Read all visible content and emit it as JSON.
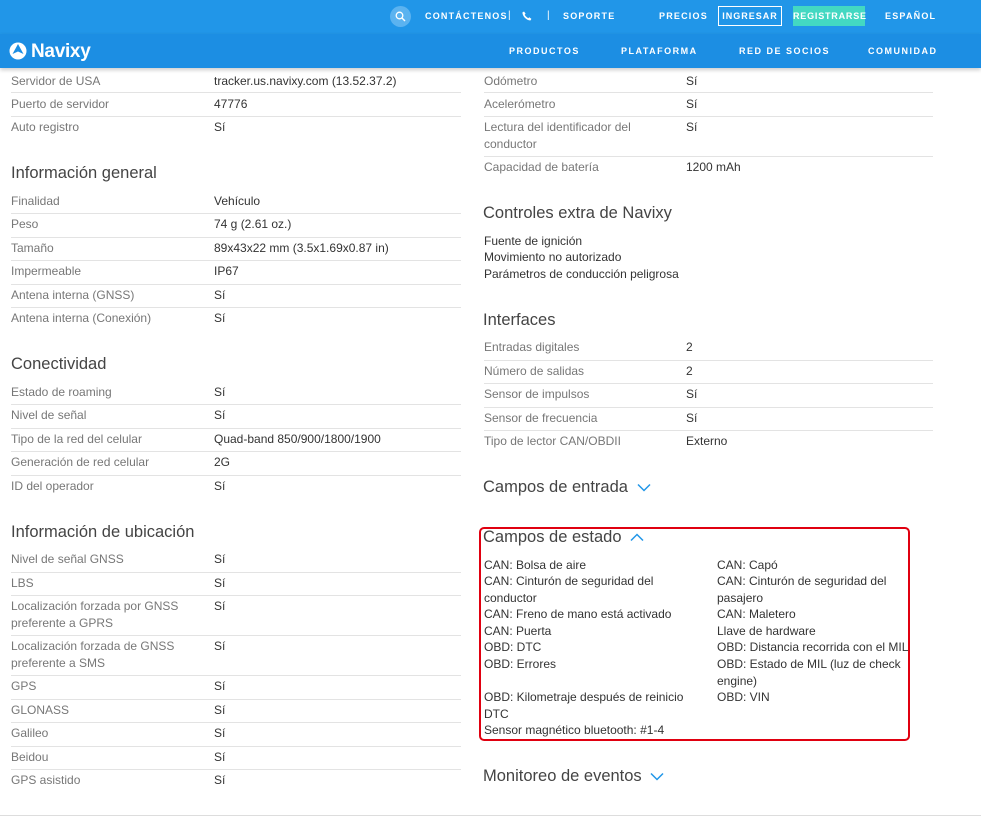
{
  "topbar": {
    "contact": "CONTÁCTENOS",
    "separator": "|",
    "support": "SOPORTE",
    "prices": "PRECIOS",
    "login": "INGRESAR",
    "register": "REGISTRARSE",
    "language": "ESPAÑOL"
  },
  "navbar": {
    "brand": "Navixy",
    "items": [
      "PRODUCTOS",
      "PLATAFORMA",
      "RED DE SOCIOS",
      "COMUNIDAD"
    ]
  },
  "left": {
    "top_rows": [
      {
        "k": "Servidor de USA",
        "v": "tracker.us.navixy.com (13.52.37.2)"
      },
      {
        "k": "Puerto de servidor",
        "v": "47776"
      },
      {
        "k": "Auto registro",
        "v": "Sí"
      }
    ],
    "general": {
      "title": "Información general",
      "rows": [
        {
          "k": "Finalidad",
          "v": "Vehículo"
        },
        {
          "k": "Peso",
          "v": "74 g (2.61 oz.)"
        },
        {
          "k": "Tamaño",
          "v": "89x43x22 mm (3.5x1.69x0.87 in)"
        },
        {
          "k": "Impermeable",
          "v": "IP67"
        },
        {
          "k": "Antena interna (GNSS)",
          "v": "Sí"
        },
        {
          "k": "Antena interna (Conexión)",
          "v": "Sí"
        }
      ]
    },
    "connectivity": {
      "title": "Conectividad",
      "rows": [
        {
          "k": "Estado de roaming",
          "v": "Sí"
        },
        {
          "k": "Nivel de señal",
          "v": "Sí"
        },
        {
          "k": "Tipo de la red del celular",
          "v": "Quad-band 850/900/1800/1900"
        },
        {
          "k": "Generación de red celular",
          "v": "2G"
        },
        {
          "k": "ID del operador",
          "v": "Sí"
        }
      ]
    },
    "location": {
      "title": "Información de ubicación",
      "rows": [
        {
          "k": "Nivel de señal GNSS",
          "v": "Sí"
        },
        {
          "k": "LBS",
          "v": "Sí"
        },
        {
          "k": "Localización forzada por GNSS preferente a GPRS",
          "v": "Sí"
        },
        {
          "k": "Localización forzada de GNSS preferente a SMS",
          "v": "Sí"
        },
        {
          "k": "GPS",
          "v": "Sí"
        },
        {
          "k": "GLONASS",
          "v": "Sí"
        },
        {
          "k": "Galileo",
          "v": "Sí"
        },
        {
          "k": "Beidou",
          "v": "Sí"
        },
        {
          "k": "GPS asistido",
          "v": "Sí"
        }
      ]
    }
  },
  "right": {
    "top_rows": [
      {
        "k": "Odómetro",
        "v": "Sí"
      },
      {
        "k": "Acelerómetro",
        "v": "Sí"
      },
      {
        "k": "Lectura del identificador del conductor",
        "v": "Sí"
      },
      {
        "k": "Capacidad de batería",
        "v": "1200 mAh"
      }
    ],
    "extra": {
      "title": "Controles extra de Navixy",
      "items": [
        "Fuente de ignición",
        "Movimiento no autorizado",
        "Parámetros de conducción peligrosa"
      ]
    },
    "interfaces": {
      "title": "Interfaces",
      "rows": [
        {
          "k": "Entradas digitales",
          "v": "2"
        },
        {
          "k": "Número de salidas",
          "v": "2"
        },
        {
          "k": "Sensor de impulsos",
          "v": "Sí"
        },
        {
          "k": "Sensor de frecuencia",
          "v": "Sí"
        },
        {
          "k": "Tipo de lector CAN/OBDII",
          "v": "Externo"
        }
      ]
    },
    "input_fields": {
      "title": "Campos de entrada"
    },
    "state_fields": {
      "title": "Campos de estado",
      "col1": [
        "CAN: Bolsa de aire",
        "CAN: Cinturón de seguridad del conductor",
        "CAN: Freno de mano está activado",
        "CAN: Puerta",
        "OBD: DTC",
        "OBD: Errores",
        "OBD: Kilometraje después de reinicio DTC",
        "Sensor magnético bluetooth: #1-4"
      ],
      "col2": [
        "CAN: Capó",
        "CAN: Cinturón de seguridad del pasajero",
        "CAN: Maletero",
        "Llave de hardware",
        "OBD: Distancia recorrida con el MIL",
        "OBD: Estado de MIL (luz de check engine)",
        "OBD: VIN"
      ]
    },
    "events": {
      "title": "Monitoreo de eventos"
    }
  },
  "colors": {
    "topbar": "#2196e8",
    "navbar": "#1c8ee3",
    "register_button": "#43d8c2",
    "highlight_border": "#e00010",
    "chevron": "#2196e8"
  }
}
